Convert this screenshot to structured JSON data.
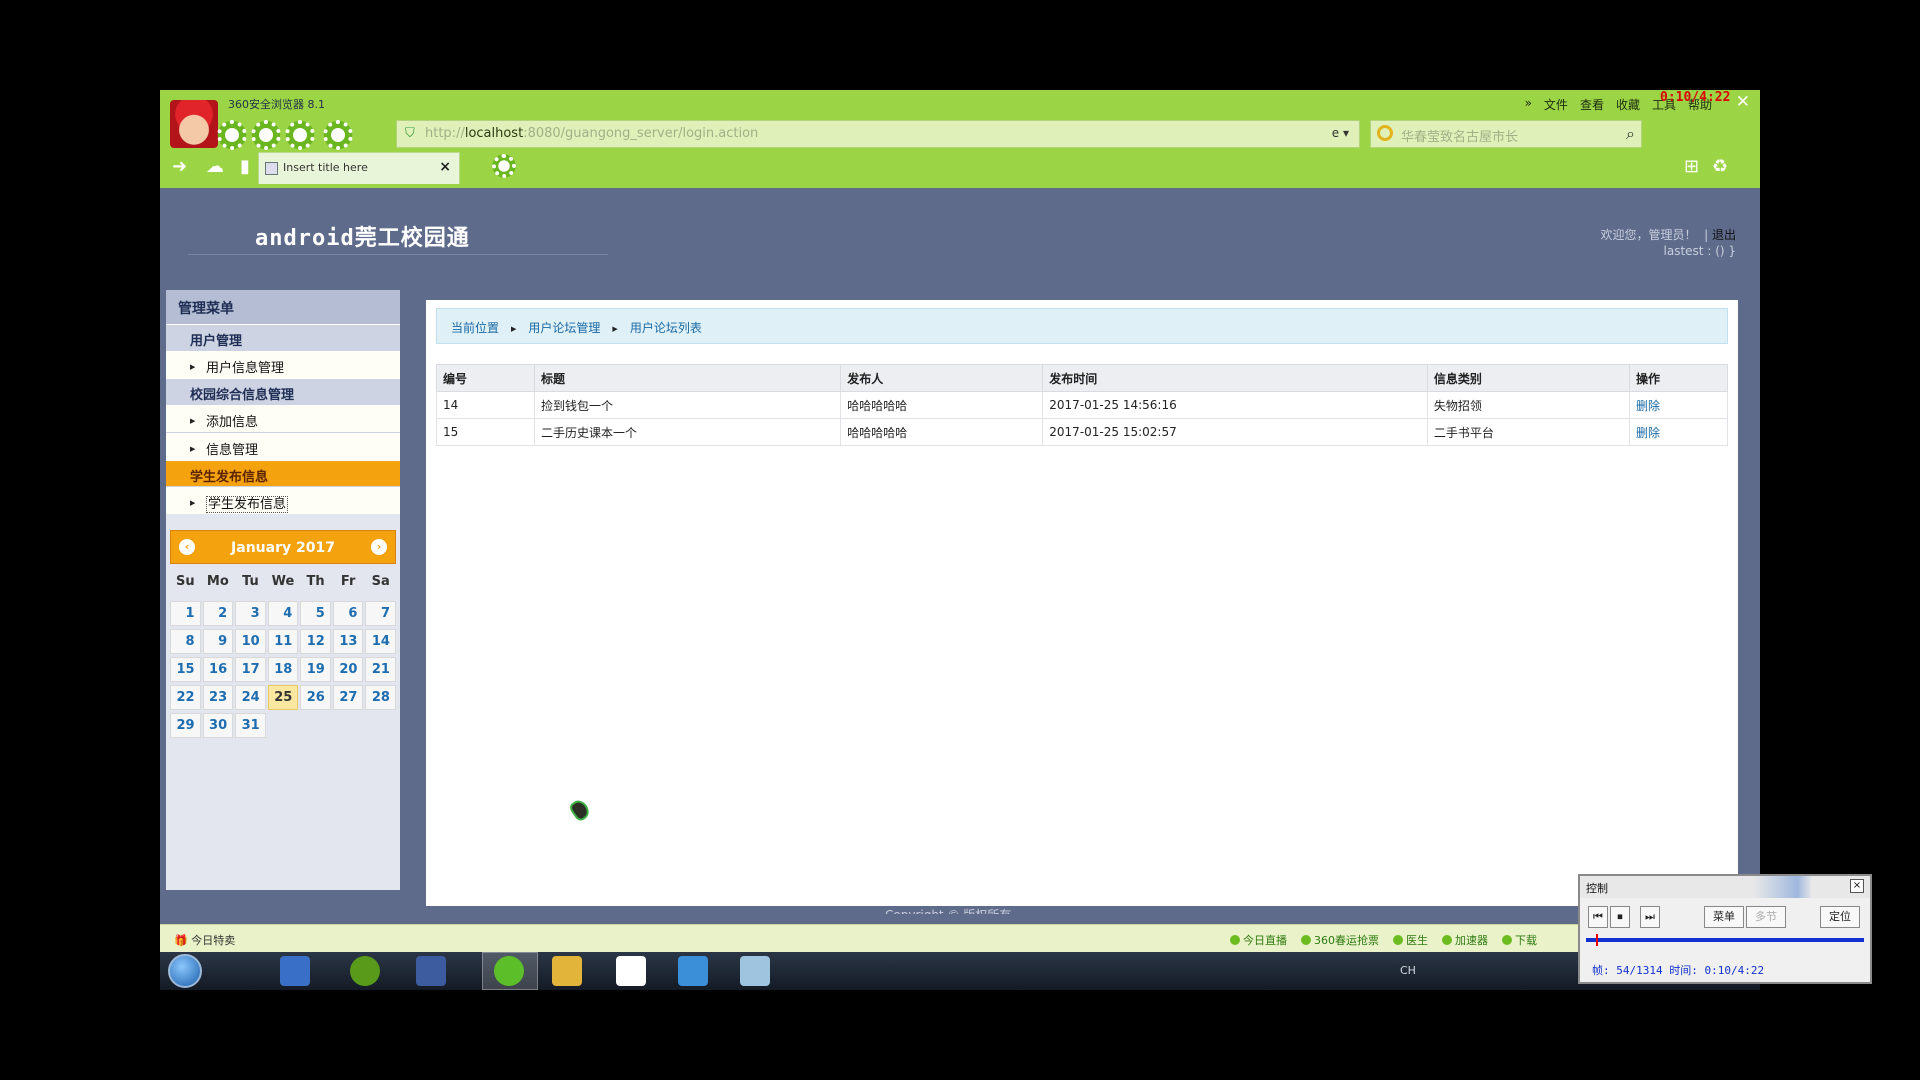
{
  "recording": {
    "timer": "0:10/4:22"
  },
  "browser": {
    "name": "360安全浏览器 8.1",
    "menu": [
      "文件",
      "查看",
      "收藏",
      "工具",
      "帮助"
    ],
    "address": {
      "proto": "http://",
      "host": "localhost",
      "rest": ":8080/guangong_server/login.action"
    },
    "search_placeholder": "华春莹致名古屋市长",
    "tab_title": "Insert title here"
  },
  "header": {
    "title": "android莞工校园通",
    "welcome": "欢迎您，管理员！",
    "logout": "退出",
    "lastest": "lastest : () }"
  },
  "sidebar": {
    "title": "管理菜单",
    "groups": [
      {
        "label": "用户管理",
        "items": [
          "用户信息管理"
        ]
      },
      {
        "label": "校园综合信息管理",
        "items": [
          "添加信息",
          "信息管理"
        ]
      },
      {
        "label": "学生发布信息",
        "items": [
          "学生发布信息"
        ]
      }
    ]
  },
  "calendar": {
    "month": "January 2017",
    "prev": "‹",
    "next": "›",
    "weekdays": [
      "Su",
      "Mo",
      "Tu",
      "We",
      "Th",
      "Fr",
      "Sa"
    ],
    "today": 25,
    "first_weekday": 0,
    "days_in_month": 31
  },
  "breadcrumb": [
    "当前位置",
    "用户论坛管理",
    "用户论坛列表"
  ],
  "table": {
    "columns": [
      "编号",
      "标题",
      "发布人",
      "发布时间",
      "信息类别",
      "操作"
    ],
    "rows": [
      [
        "14",
        "捡到钱包一个",
        "哈哈哈哈哈",
        "2017-01-25 14:56:16",
        "失物招领",
        "删除"
      ],
      [
        "15",
        "二手历史课本一个",
        "哈哈哈哈哈",
        "2017-01-25 15:02:57",
        "二手书平台",
        "删除"
      ]
    ]
  },
  "copyright": "Copyright © 版权所有",
  "statusbar": {
    "deal": "今日特卖",
    "links": [
      "今日直播",
      "360春运抢票",
      "医生",
      "加速器",
      "下载"
    ]
  },
  "taskbar": {
    "lang": "CH"
  },
  "player": {
    "title": "控制",
    "buttons": [
      "菜单",
      "多节",
      "定位"
    ],
    "status": "帧: 54/1314 时间: 0:10/4:22"
  }
}
